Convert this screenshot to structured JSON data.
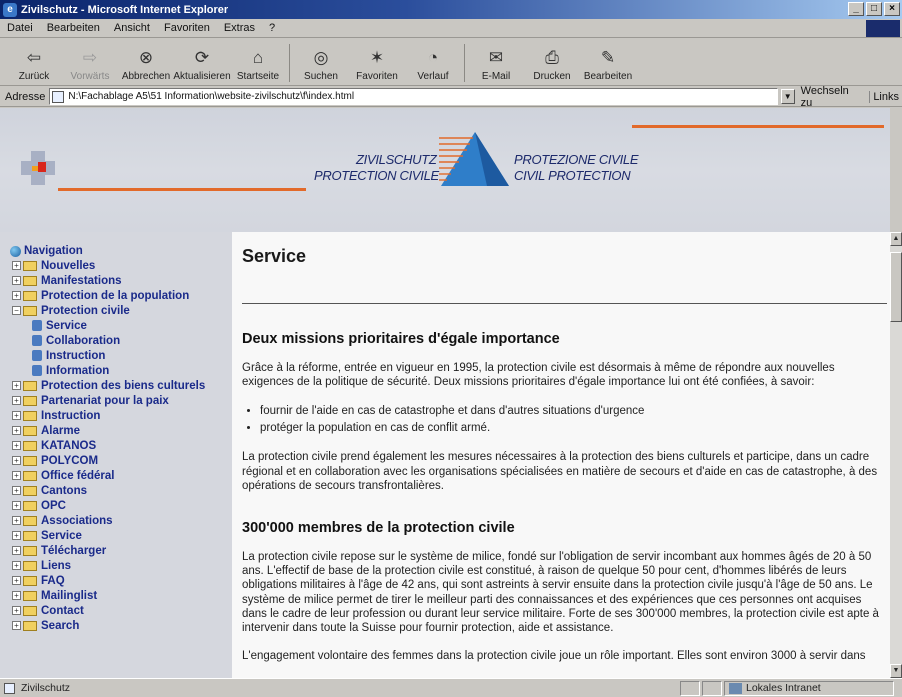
{
  "window": {
    "title": "Zivilschutz - Microsoft Internet Explorer"
  },
  "menu": [
    "Datei",
    "Bearbeiten",
    "Ansicht",
    "Favoriten",
    "Extras",
    "?"
  ],
  "toolbar": {
    "back": "Zurück",
    "forward": "Vorwärts",
    "stop": "Abbrechen",
    "refresh": "Aktualisieren",
    "home": "Startseite",
    "search": "Suchen",
    "favorites": "Favoriten",
    "history": "Verlauf",
    "mail": "E-Mail",
    "print": "Drucken",
    "edit": "Bearbeiten"
  },
  "address": {
    "label": "Adresse",
    "url": "N:\\Fachablage A5\\51 Information\\website-zivilschutz\\f\\index.html",
    "go": "Wechseln zu",
    "links": "Links"
  },
  "header": {
    "de": "ZIVILSCHUTZ",
    "fr": "PROTECTION CIVILE",
    "it": "PROTEZIONE CIVILE",
    "en": "CIVIL PROTECTION"
  },
  "nav": {
    "root": "Navigation",
    "items_before": [
      "Nouvelles",
      "Manifestations",
      "Protection de la population"
    ],
    "expanded": "Protection civile",
    "sub": [
      "Service",
      "Collaboration",
      "Instruction",
      "Information"
    ],
    "items_after": [
      "Protection des biens culturels",
      "Partenariat pour la paix",
      "Instruction",
      "Alarme",
      "KATANOS",
      "POLYCOM",
      "Office fédéral",
      "Cantons",
      "OPC",
      "Associations",
      "Service",
      "Télécharger",
      "Liens",
      "FAQ",
      "Mailinglist",
      "Contact",
      "Search"
    ]
  },
  "page": {
    "title": "Service",
    "h2_1": "Deux missions prioritaires d'égale importance",
    "p1": "Grâce à la réforme, entrée en vigueur en 1995, la protection civile est désormais à même de répondre aux nouvelles exigences de la politique de sécurité. Deux missions prioritaires d'égale importance lui ont été confiées, à savoir:",
    "bullets": [
      "fournir de l'aide en cas de catastrophe et dans d'autres situations d'urgence",
      "protéger la population en cas de conflit armé."
    ],
    "p2": "La protection civile prend également les mesures nécessaires à la protection des biens culturels et participe, dans un cadre régional et en collaboration avec les organisations spécialisées en matière de secours et d'aide en cas de catastrophe, à des opérations de secours transfrontalières.",
    "h2_2": "300'000 membres de la protection civile",
    "p3": "La protection civile repose sur le système de milice, fondé sur l'obligation de servir incombant aux hommes âgés de 20 à 50 ans. L'effectif de base de la protection civile est constitué, à raison de quelque 50 pour cent, d'hommes libérés de leurs obligations militaires à l'âge de 42 ans, qui sont astreints à servir ensuite dans la protection civile jusqu'à l'âge de 50 ans. Le système de milice permet de tirer le meilleur parti des connaissances et des expériences que ces personnes ont acquises dans le cadre de leur profession ou durant leur service militaire. Forte de ses 300'000 membres, la protection civile est apte à intervenir dans toute la Suisse pour fournir protection, aide et assistance.",
    "p4": "L'engagement volontaire des femmes dans la protection civile joue un rôle important. Elles sont environ 3000 à servir dans"
  },
  "status": {
    "left": "Zivilschutz",
    "zone": "Lokales Intranet"
  },
  "colors": {
    "accent_orange": "#e26a2a",
    "nav_blue": "#1a2a8a",
    "header_navy": "#1d2a6b"
  }
}
